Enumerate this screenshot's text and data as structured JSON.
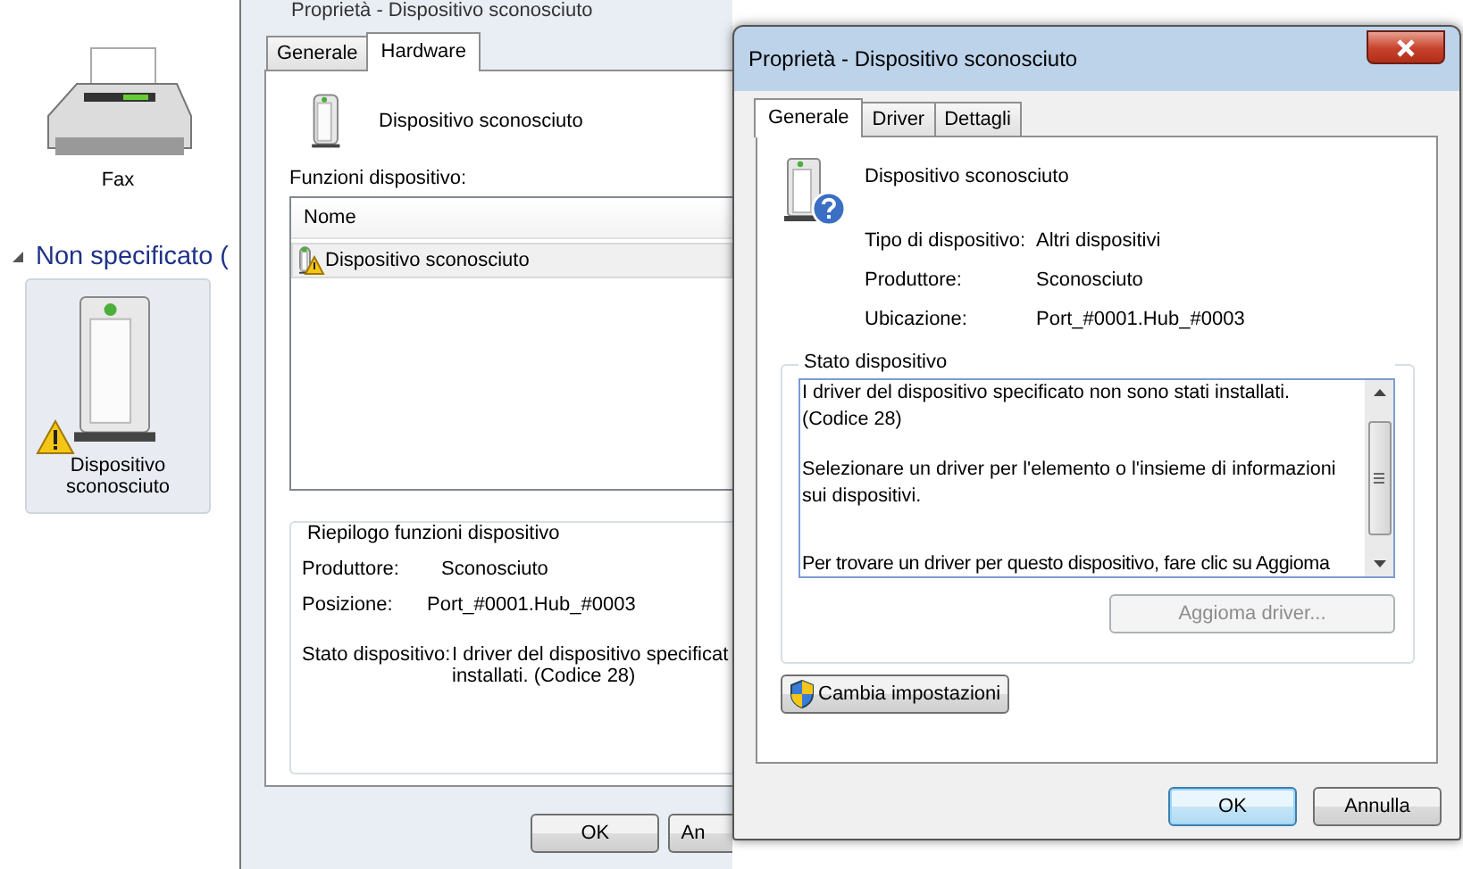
{
  "explorer": {
    "items": [
      {
        "label": "Fax",
        "kind": "fax",
        "selected": false
      }
    ],
    "group": {
      "label": "Non specificato (",
      "expanded": true
    },
    "group_items": [
      {
        "label": "Dispositivo sconosciuto",
        "kind": "device",
        "selected": true,
        "warning": true
      }
    ]
  },
  "back_dialog": {
    "title": "Proprietà - Dispositivo sconosciuto",
    "tabs": [
      {
        "label": "Generale",
        "selected": false
      },
      {
        "label": "Hardware",
        "selected": true
      }
    ],
    "device_name": "Dispositivo sconosciuto",
    "functions_label": "Funzioni dispositivo:",
    "list": {
      "columns": [
        "Nome"
      ],
      "rows": [
        {
          "name": "Dispositivo sconosciuto",
          "warning": true,
          "selected": true
        }
      ]
    },
    "summary": {
      "title": "Riepilogo funzioni dispositivo",
      "fields": [
        {
          "label": "Produttore:",
          "value": [
            "Sconosciuto"
          ]
        },
        {
          "label": "Posizione:",
          "value": [
            "Port_#0001.Hub_#0003"
          ]
        },
        {
          "label": "Stato dispositivo:",
          "value": [
            "I driver del dispositivo specificat",
            "installati. (Codice 28)"
          ]
        }
      ]
    },
    "buttons": [
      {
        "label": "OK",
        "default": false
      },
      {
        "label": "An",
        "default": false
      }
    ]
  },
  "front_dialog": {
    "title": "Proprietà - Dispositivo sconosciuto",
    "tabs": [
      {
        "label": "Generale",
        "selected": true
      },
      {
        "label": "Driver",
        "selected": false
      },
      {
        "label": "Dettagli",
        "selected": false
      }
    ],
    "device_name": "Dispositivo sconosciuto",
    "properties": [
      {
        "label": "Tipo di dispositivo:",
        "value": "Altri dispositivi"
      },
      {
        "label": "Produttore:",
        "value": "Sconosciuto"
      },
      {
        "label": "Ubicazione:",
        "value": "Port_#0001.Hub_#0003"
      }
    ],
    "status": {
      "title": "Stato dispositivo",
      "paragraphs": [
        "I driver del dispositivo specificato non sono stati installati. (Codice 28)",
        "Selezionare un driver per l'elemento o l'insieme di informazioni sui dispositivi.",
        "Per trovare un driver per questo dispositivo, fare clic su Aggioma"
      ]
    },
    "update_button": {
      "label": "Aggioma driver...",
      "disabled": true
    },
    "settings_button": {
      "label": "Cambia impostazioni"
    },
    "buttons": [
      {
        "label": "OK",
        "default": true
      },
      {
        "label": "Annulla",
        "default": false
      }
    ]
  }
}
